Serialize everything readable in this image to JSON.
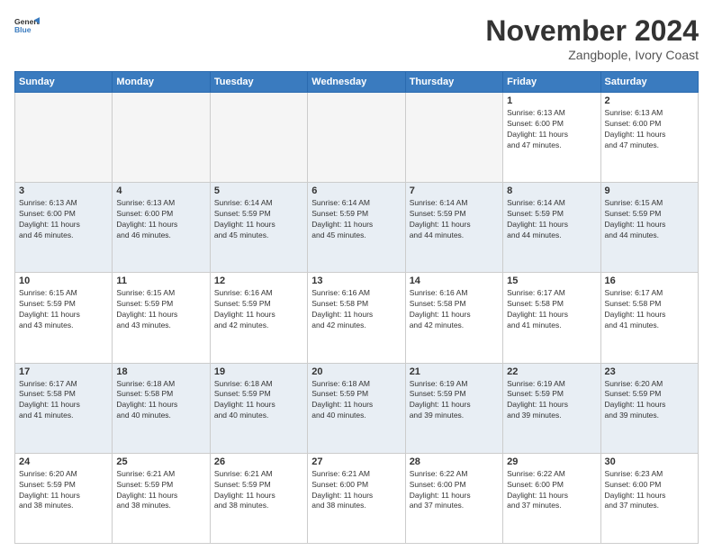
{
  "logo": {
    "line1": "General",
    "line2": "Blue"
  },
  "title": "November 2024",
  "location": "Zangbople, Ivory Coast",
  "weekdays": [
    "Sunday",
    "Monday",
    "Tuesday",
    "Wednesday",
    "Thursday",
    "Friday",
    "Saturday"
  ],
  "weeks": [
    [
      {
        "day": "",
        "info": ""
      },
      {
        "day": "",
        "info": ""
      },
      {
        "day": "",
        "info": ""
      },
      {
        "day": "",
        "info": ""
      },
      {
        "day": "",
        "info": ""
      },
      {
        "day": "1",
        "info": "Sunrise: 6:13 AM\nSunset: 6:00 PM\nDaylight: 11 hours\nand 47 minutes."
      },
      {
        "day": "2",
        "info": "Sunrise: 6:13 AM\nSunset: 6:00 PM\nDaylight: 11 hours\nand 47 minutes."
      }
    ],
    [
      {
        "day": "3",
        "info": "Sunrise: 6:13 AM\nSunset: 6:00 PM\nDaylight: 11 hours\nand 46 minutes."
      },
      {
        "day": "4",
        "info": "Sunrise: 6:13 AM\nSunset: 6:00 PM\nDaylight: 11 hours\nand 46 minutes."
      },
      {
        "day": "5",
        "info": "Sunrise: 6:14 AM\nSunset: 5:59 PM\nDaylight: 11 hours\nand 45 minutes."
      },
      {
        "day": "6",
        "info": "Sunrise: 6:14 AM\nSunset: 5:59 PM\nDaylight: 11 hours\nand 45 minutes."
      },
      {
        "day": "7",
        "info": "Sunrise: 6:14 AM\nSunset: 5:59 PM\nDaylight: 11 hours\nand 44 minutes."
      },
      {
        "day": "8",
        "info": "Sunrise: 6:14 AM\nSunset: 5:59 PM\nDaylight: 11 hours\nand 44 minutes."
      },
      {
        "day": "9",
        "info": "Sunrise: 6:15 AM\nSunset: 5:59 PM\nDaylight: 11 hours\nand 44 minutes."
      }
    ],
    [
      {
        "day": "10",
        "info": "Sunrise: 6:15 AM\nSunset: 5:59 PM\nDaylight: 11 hours\nand 43 minutes."
      },
      {
        "day": "11",
        "info": "Sunrise: 6:15 AM\nSunset: 5:59 PM\nDaylight: 11 hours\nand 43 minutes."
      },
      {
        "day": "12",
        "info": "Sunrise: 6:16 AM\nSunset: 5:59 PM\nDaylight: 11 hours\nand 42 minutes."
      },
      {
        "day": "13",
        "info": "Sunrise: 6:16 AM\nSunset: 5:58 PM\nDaylight: 11 hours\nand 42 minutes."
      },
      {
        "day": "14",
        "info": "Sunrise: 6:16 AM\nSunset: 5:58 PM\nDaylight: 11 hours\nand 42 minutes."
      },
      {
        "day": "15",
        "info": "Sunrise: 6:17 AM\nSunset: 5:58 PM\nDaylight: 11 hours\nand 41 minutes."
      },
      {
        "day": "16",
        "info": "Sunrise: 6:17 AM\nSunset: 5:58 PM\nDaylight: 11 hours\nand 41 minutes."
      }
    ],
    [
      {
        "day": "17",
        "info": "Sunrise: 6:17 AM\nSunset: 5:58 PM\nDaylight: 11 hours\nand 41 minutes."
      },
      {
        "day": "18",
        "info": "Sunrise: 6:18 AM\nSunset: 5:58 PM\nDaylight: 11 hours\nand 40 minutes."
      },
      {
        "day": "19",
        "info": "Sunrise: 6:18 AM\nSunset: 5:59 PM\nDaylight: 11 hours\nand 40 minutes."
      },
      {
        "day": "20",
        "info": "Sunrise: 6:18 AM\nSunset: 5:59 PM\nDaylight: 11 hours\nand 40 minutes."
      },
      {
        "day": "21",
        "info": "Sunrise: 6:19 AM\nSunset: 5:59 PM\nDaylight: 11 hours\nand 39 minutes."
      },
      {
        "day": "22",
        "info": "Sunrise: 6:19 AM\nSunset: 5:59 PM\nDaylight: 11 hours\nand 39 minutes."
      },
      {
        "day": "23",
        "info": "Sunrise: 6:20 AM\nSunset: 5:59 PM\nDaylight: 11 hours\nand 39 minutes."
      }
    ],
    [
      {
        "day": "24",
        "info": "Sunrise: 6:20 AM\nSunset: 5:59 PM\nDaylight: 11 hours\nand 38 minutes."
      },
      {
        "day": "25",
        "info": "Sunrise: 6:21 AM\nSunset: 5:59 PM\nDaylight: 11 hours\nand 38 minutes."
      },
      {
        "day": "26",
        "info": "Sunrise: 6:21 AM\nSunset: 5:59 PM\nDaylight: 11 hours\nand 38 minutes."
      },
      {
        "day": "27",
        "info": "Sunrise: 6:21 AM\nSunset: 6:00 PM\nDaylight: 11 hours\nand 38 minutes."
      },
      {
        "day": "28",
        "info": "Sunrise: 6:22 AM\nSunset: 6:00 PM\nDaylight: 11 hours\nand 37 minutes."
      },
      {
        "day": "29",
        "info": "Sunrise: 6:22 AM\nSunset: 6:00 PM\nDaylight: 11 hours\nand 37 minutes."
      },
      {
        "day": "30",
        "info": "Sunrise: 6:23 AM\nSunset: 6:00 PM\nDaylight: 11 hours\nand 37 minutes."
      }
    ]
  ]
}
